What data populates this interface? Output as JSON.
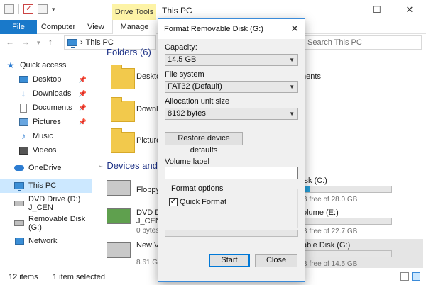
{
  "window": {
    "title": "This PC",
    "context_tab": "Drive Tools",
    "controls": {
      "minimize": "—",
      "maximize": "☐",
      "close": "✕"
    }
  },
  "ribbon": {
    "tabs": [
      {
        "label": "File"
      },
      {
        "label": "Computer"
      },
      {
        "label": "View"
      },
      {
        "label": "Manage"
      }
    ]
  },
  "address": {
    "path": "This PC",
    "separator": "›",
    "search_placeholder": "Search This PC"
  },
  "nav": {
    "items": [
      {
        "label": "Quick access",
        "icon": "star-icon",
        "pinned": false
      },
      {
        "label": "Desktop",
        "icon": "desktop-icon",
        "pinned": true
      },
      {
        "label": "Downloads",
        "icon": "download-icon",
        "pinned": true
      },
      {
        "label": "Documents",
        "icon": "documents-icon",
        "pinned": true
      },
      {
        "label": "Pictures",
        "icon": "pictures-icon",
        "pinned": true
      },
      {
        "label": "Music",
        "icon": "music-icon",
        "pinned": false
      },
      {
        "label": "Videos",
        "icon": "videos-icon",
        "pinned": false
      },
      {
        "label": "OneDrive",
        "icon": "cloud-icon",
        "pinned": false
      },
      {
        "label": "This PC",
        "icon": "pc-icon",
        "pinned": false,
        "selected": true
      },
      {
        "label": "DVD Drive (D:) J_CEN",
        "icon": "dvd-icon",
        "pinned": false
      },
      {
        "label": "Removable Disk (G:)",
        "icon": "drive-icon",
        "pinned": false
      },
      {
        "label": "Network",
        "icon": "network-icon",
        "pinned": false
      }
    ]
  },
  "content": {
    "folders_header": "Folders (6)",
    "folders": [
      {
        "label": "Desktop",
        "ghost": "ments"
      },
      {
        "label": "Downlo"
      },
      {
        "label": "Picture"
      }
    ],
    "devices_header": "Devices and c",
    "devices_left": [
      {
        "name": "Floppy",
        "free": ""
      },
      {
        "name": "DVD Dr",
        "name2": "J_CENA",
        "free": "0 bytes"
      },
      {
        "name": "New Vo",
        "free": "8.61 GB"
      }
    ],
    "devices_right": [
      {
        "name": "isk (C:)",
        "free": "B free of 28.0 GB",
        "used_fraction": 0.12
      },
      {
        "name": "olume (E:)",
        "free": "B free of 22.7 GB",
        "used_fraction": 0
      },
      {
        "name": "able Disk (G:)",
        "free": "B free of 14.5 GB",
        "used_fraction": 0
      }
    ]
  },
  "status": {
    "items_count": "12 items",
    "selected_count": "1 item selected"
  },
  "dialog": {
    "title": "Format Removable Disk (G:)",
    "capacity_label": "Capacity:",
    "capacity_value": "14.5 GB",
    "filesystem_label": "File system",
    "filesystem_value": "FAT32 (Default)",
    "alloc_label": "Allocation unit size",
    "alloc_value": "8192 bytes",
    "restore_button": "Restore device defaults",
    "volume_label": "Volume label",
    "volume_value": "",
    "format_options_label": "Format options",
    "quick_format_label": "Quick Format",
    "quick_format_checked": true,
    "progress_fraction": 0,
    "start_button": "Start",
    "close_button": "Close"
  }
}
